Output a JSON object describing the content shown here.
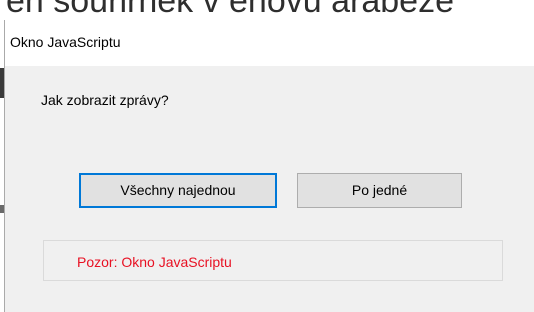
{
  "background": {
    "page_text": "en souhrnek v enovu arabeze"
  },
  "dialog": {
    "title": "Okno JavaScriptu",
    "prompt": "Jak zobrazit zprávy?",
    "buttons": {
      "all_at_once": "Všechny najednou",
      "one_by_one": "Po jedné"
    },
    "notice": "Pozor: Okno JavaScriptu"
  },
  "colors": {
    "focus_border": "#0078d7",
    "notice_text": "#e81123",
    "dialog_bg": "#f0f0f0",
    "titlebar_bg": "#ffffff"
  }
}
